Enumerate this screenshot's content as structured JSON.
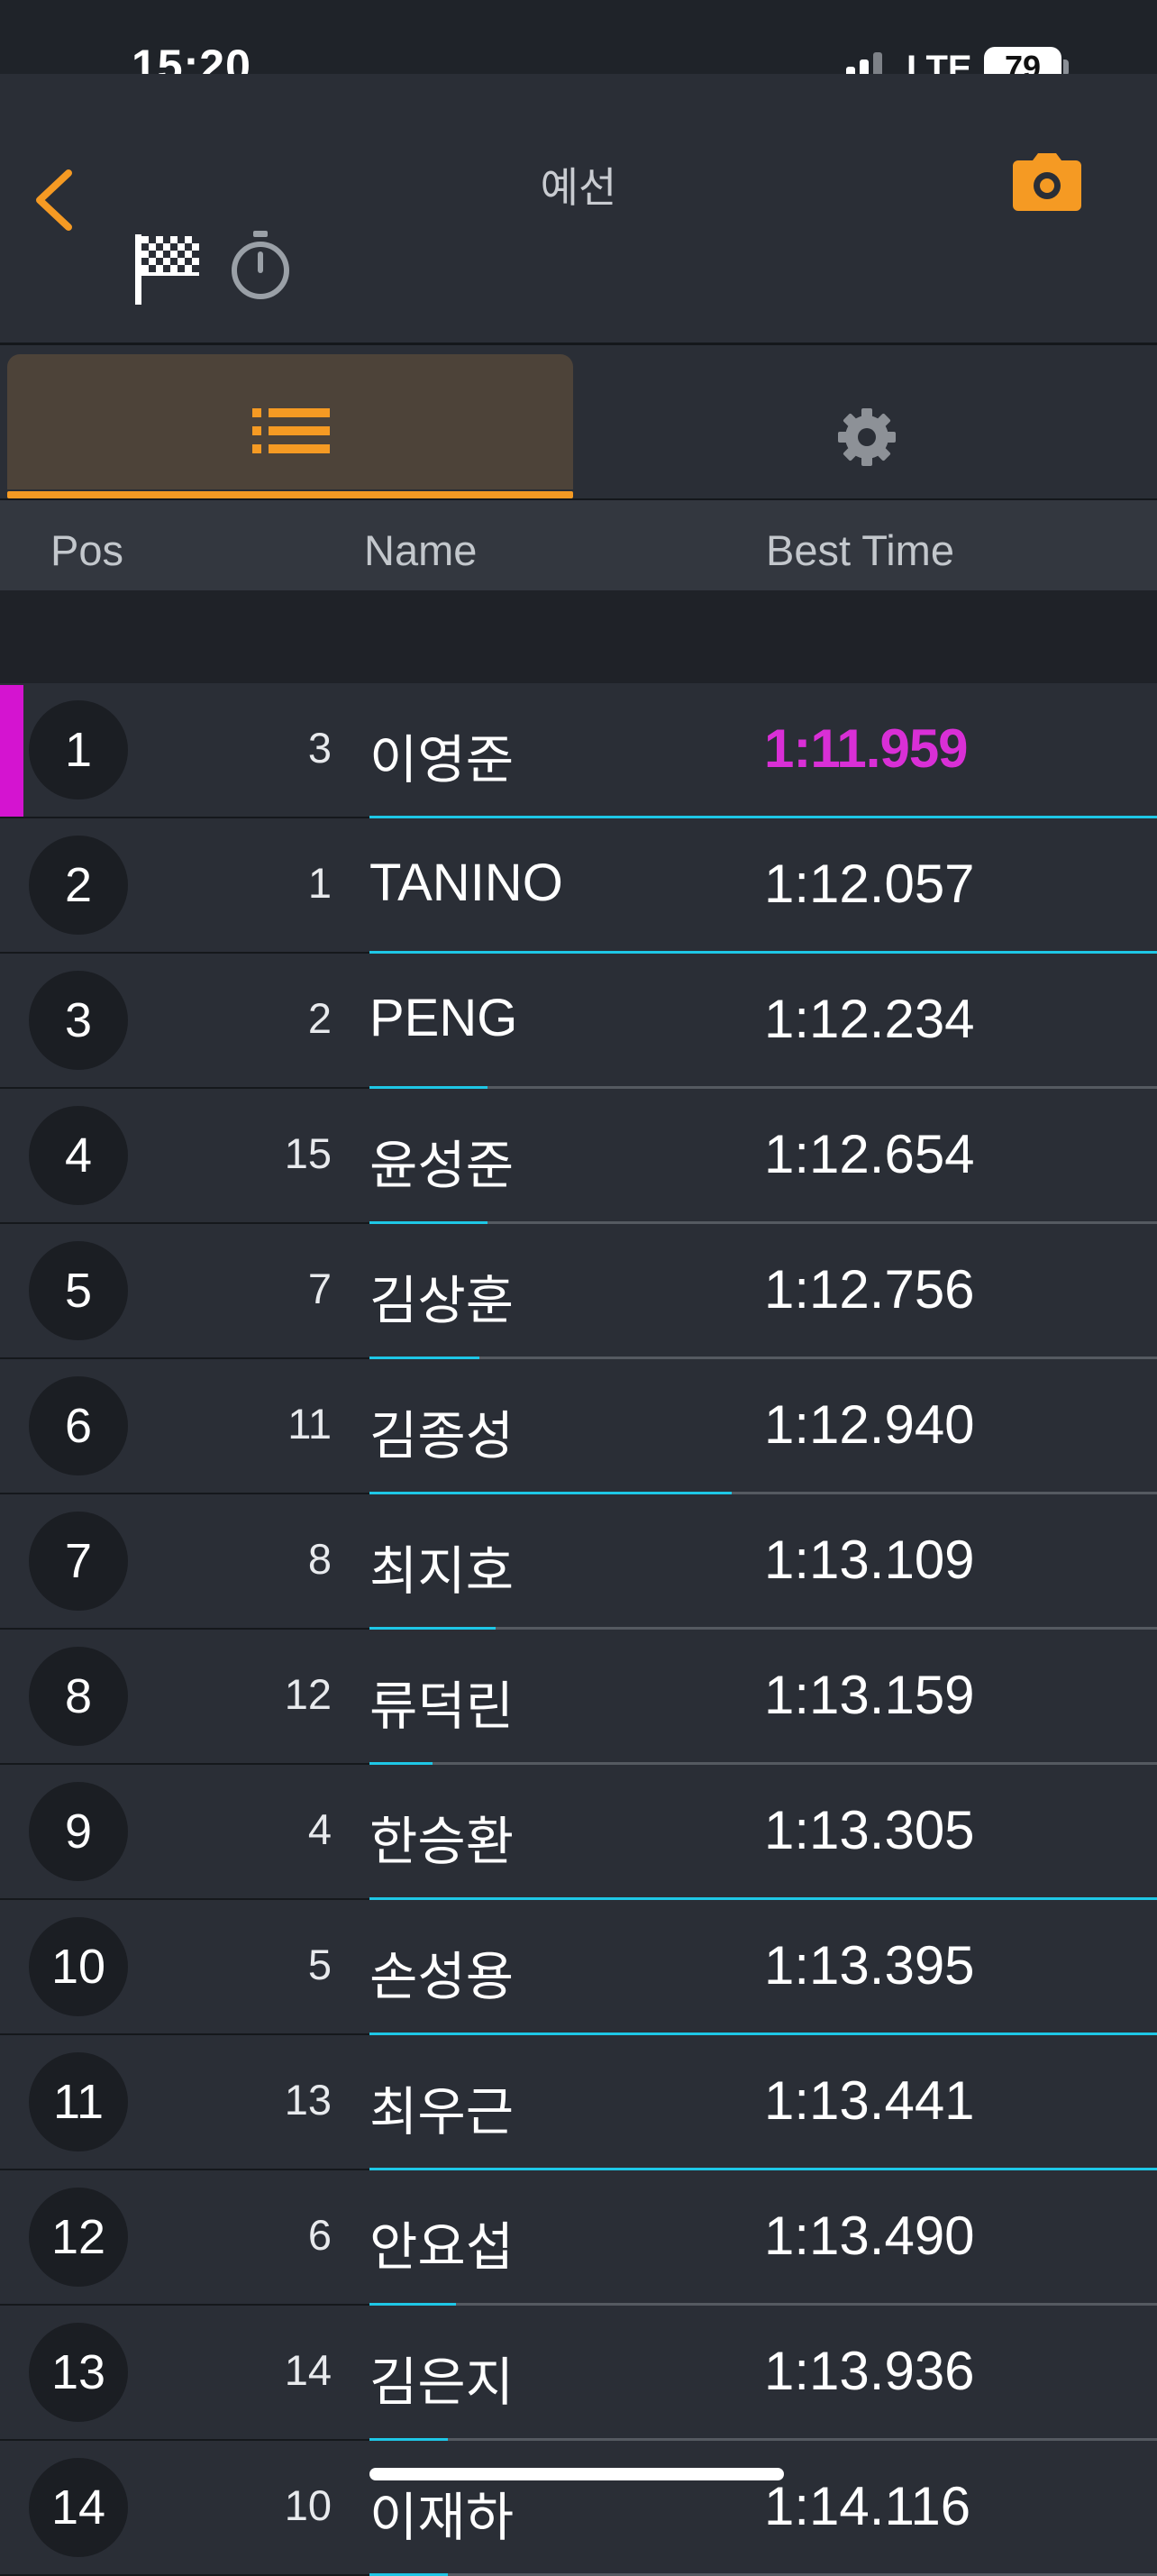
{
  "status_bar": {
    "time": "15:20",
    "network": "LTE",
    "battery": "79"
  },
  "header": {
    "title": "예선",
    "icons": [
      "back-chevron-icon",
      "checkered-flag-icon",
      "stopwatch-icon",
      "camera-icon"
    ]
  },
  "tabs": [
    {
      "icon": "list-icon",
      "selected": true
    },
    {
      "icon": "gear-icon",
      "selected": false
    }
  ],
  "columns": {
    "pos": "Pos",
    "name": "Name",
    "best_time": "Best Time"
  },
  "colors": {
    "accent": "#f59a23",
    "fastest": "#d92fd6",
    "progress": "#1ec7e6",
    "background": "#2a2e36"
  },
  "rows": [
    {
      "pos": "1",
      "no": "3",
      "name": "이영준",
      "time": "1:11.959",
      "fastest": true,
      "progress": 1.0
    },
    {
      "pos": "2",
      "no": "1",
      "name": "TANINO",
      "time": "1:12.057",
      "fastest": false,
      "progress": 1.0
    },
    {
      "pos": "3",
      "no": "2",
      "name": "PENG",
      "time": "1:12.234",
      "fastest": false,
      "progress": 0.15
    },
    {
      "pos": "4",
      "no": "15",
      "name": "윤성준",
      "time": "1:12.654",
      "fastest": false,
      "progress": 0.15
    },
    {
      "pos": "5",
      "no": "7",
      "name": "김상훈",
      "time": "1:12.756",
      "fastest": false,
      "progress": 0.14
    },
    {
      "pos": "6",
      "no": "11",
      "name": "김종성",
      "time": "1:12.940",
      "fastest": false,
      "progress": 0.46
    },
    {
      "pos": "7",
      "no": "8",
      "name": "최지호",
      "time": "1:13.109",
      "fastest": false,
      "progress": 0.16
    },
    {
      "pos": "8",
      "no": "12",
      "name": "류덕린",
      "time": "1:13.159",
      "fastest": false,
      "progress": 0.08
    },
    {
      "pos": "9",
      "no": "4",
      "name": "한승환",
      "time": "1:13.305",
      "fastest": false,
      "progress": 1.0
    },
    {
      "pos": "10",
      "no": "5",
      "name": "손성용",
      "time": "1:13.395",
      "fastest": false,
      "progress": 1.0
    },
    {
      "pos": "11",
      "no": "13",
      "name": "최우근",
      "time": "1:13.441",
      "fastest": false,
      "progress": 1.0
    },
    {
      "pos": "12",
      "no": "6",
      "name": "안요섭",
      "time": "1:13.490",
      "fastest": false,
      "progress": 0.11
    },
    {
      "pos": "13",
      "no": "14",
      "name": "김은지",
      "time": "1:13.936",
      "fastest": false,
      "progress": 0.1
    },
    {
      "pos": "14",
      "no": "10",
      "name": "이재하",
      "time": "1:14.116",
      "fastest": false,
      "progress": 0.1
    }
  ]
}
